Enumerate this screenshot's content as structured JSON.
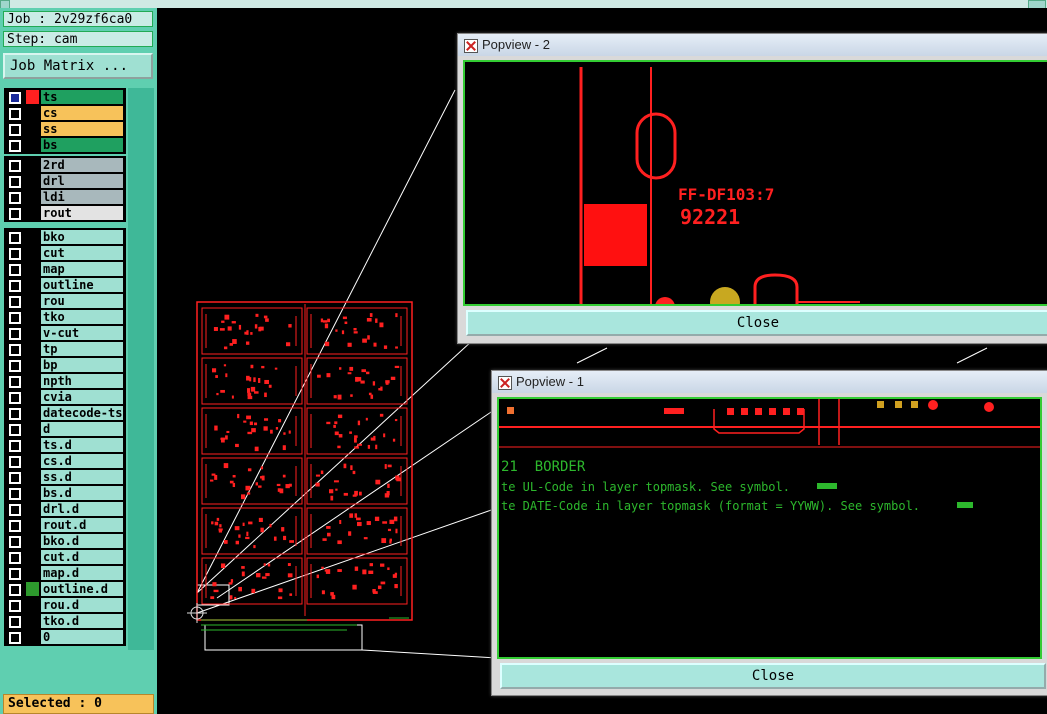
{
  "job": {
    "label": "Job : 2v29zf6ca0",
    "step": "Step: cam",
    "matrix_button": "Job Matrix ..."
  },
  "layers": [
    {
      "items": [
        {
          "name": "ts",
          "color": "#1fa060",
          "active": true
        },
        {
          "name": "cs",
          "color": "#f7c25a"
        },
        {
          "name": "ss",
          "color": "#f7c25a"
        },
        {
          "name": "bs",
          "color": "#1fa060"
        }
      ]
    },
    {
      "items": [
        {
          "name": "2rd",
          "color": "#a8b8bc"
        },
        {
          "name": "drl",
          "color": "#a8b8bc"
        },
        {
          "name": "ldi",
          "color": "#a8b8bc"
        },
        {
          "name": "rout",
          "color": "#e3e3e3"
        }
      ]
    },
    {
      "items": [
        {
          "name": "bko"
        },
        {
          "name": "cut"
        },
        {
          "name": "map"
        },
        {
          "name": "outline"
        },
        {
          "name": "rou"
        },
        {
          "name": "tko"
        },
        {
          "name": "v-cut"
        },
        {
          "name": "tp"
        },
        {
          "name": "bp"
        },
        {
          "name": "npth"
        },
        {
          "name": "cvia"
        },
        {
          "name": "datecode-ts"
        },
        {
          "name": "d"
        },
        {
          "name": "ts.d"
        },
        {
          "name": "cs.d"
        },
        {
          "name": "ss.d"
        },
        {
          "name": "bs.d"
        },
        {
          "name": "drl.d"
        },
        {
          "name": "rout.d"
        },
        {
          "name": "bko.d"
        },
        {
          "name": "cut.d"
        },
        {
          "name": "map.d"
        },
        {
          "name": "outline.d",
          "marker": "#2d9a2d"
        },
        {
          "name": "rou.d"
        },
        {
          "name": "tko.d"
        },
        {
          "name": "0"
        }
      ]
    }
  ],
  "selected": "Selected : 0",
  "popup2": {
    "title": "Popview - 2",
    "text_code": "FF-DF103:7",
    "text_num": "92221",
    "close": "Close"
  },
  "popup1": {
    "title": "Popview - 1",
    "lines": [
      "21  BORDER",
      "te UL-Code in layer topmask. See symbol.",
      "te DATE-Code in layer topmask (format = YYWW). See symbol."
    ],
    "close": "Close"
  },
  "colors": {
    "panel": "#5fcfb0",
    "layer_default": "#9fe0d2",
    "board": "#ff2020",
    "note": "#2db82d"
  }
}
